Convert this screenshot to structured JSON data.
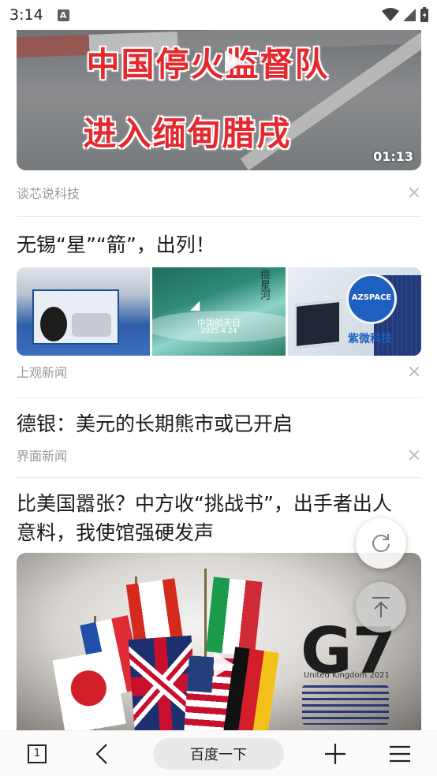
{
  "status_bar": {
    "time": "3:14",
    "notif_icon_label": "A"
  },
  "feed": {
    "top_video": {
      "overlay_line1": "中国停火监督队",
      "overlay_line2": "进入缅甸腊戌",
      "duration": "01:13",
      "source": "谈芯说科技"
    },
    "article_stars": {
      "title": "无锡“星”“箭”，出列！",
      "thumb2_caption": "中国航天日",
      "thumb2_date": "2025.4.24",
      "thumb2_vertical": "揽星河",
      "thumb3_sign": "AZSPACE",
      "thumb3_brand": "紫微科技",
      "source": "上观新闻"
    },
    "article_dollar": {
      "title": "德银：美元的长期熊市或已开启",
      "source": "界面新闻"
    },
    "article_challenge": {
      "title": "比美国嚣张？中方收“挑战书”，出手者出人意料，我使馆强硬发声",
      "video_logo": "G7",
      "video_logo_sub": "United Kingdom 2021"
    }
  },
  "bottom_nav": {
    "tab_count": "1",
    "search_label": "百度一下"
  },
  "colors": {
    "accent_red": "#e5282e",
    "source_gray": "#999999"
  }
}
